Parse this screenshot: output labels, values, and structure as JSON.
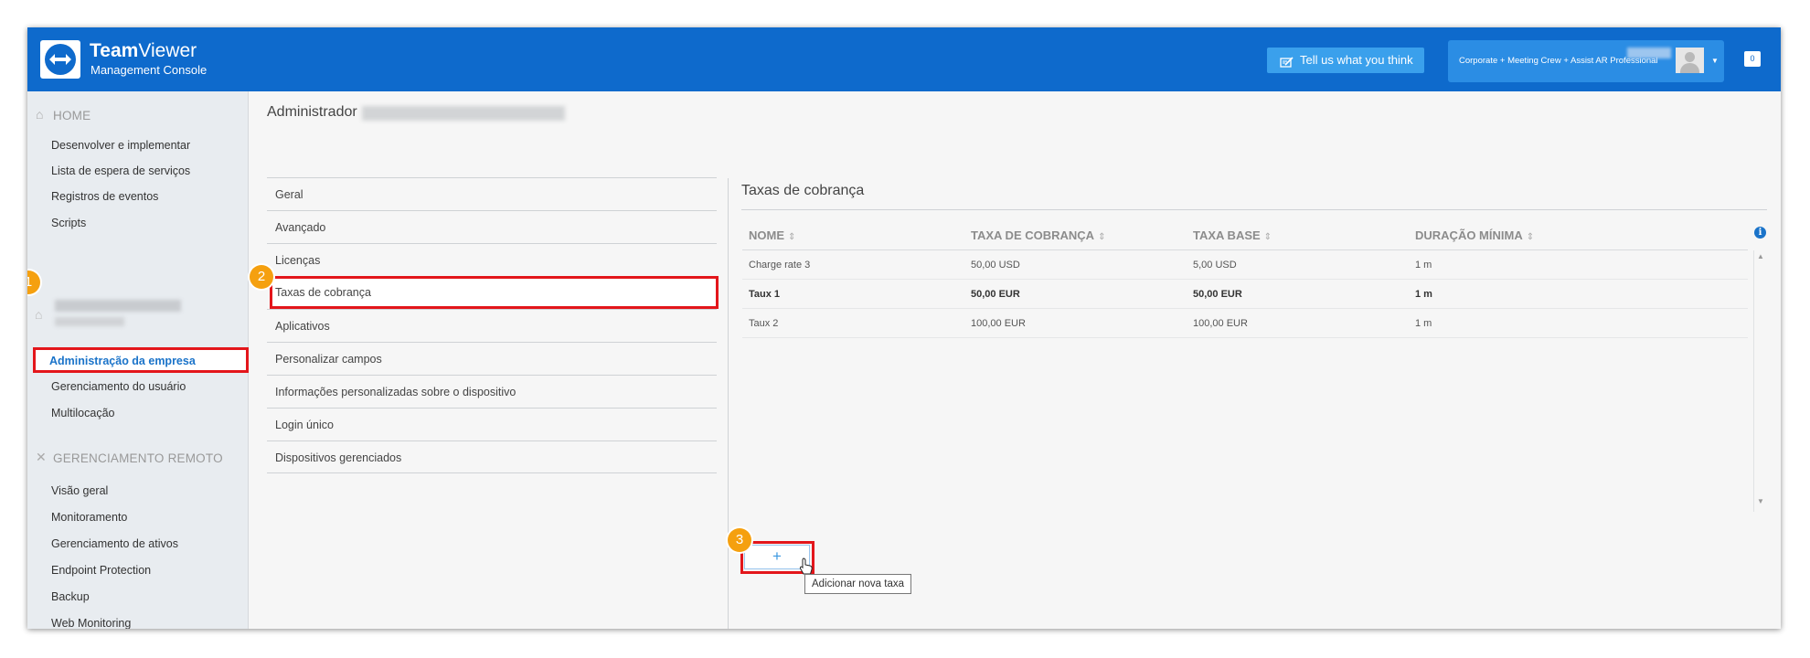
{
  "header": {
    "brand_bold": "Team",
    "brand_regular": "Viewer",
    "brand_subtitle": "Management Console",
    "feedback_label": "Tell us what you think",
    "license_label": "Corporate + Meeting Crew + Assist AR Professional",
    "notification_count": "0",
    "accent_color": "#0e6acc"
  },
  "sidebar": {
    "home_title": "HOME",
    "home_items": [
      "Desenvolver e implementar",
      "Lista de espera de serviços",
      "Registros de eventos",
      "Scripts"
    ],
    "company_items": [
      "Administração da empresa",
      "Gerenciamento do usuário",
      "Multilocação"
    ],
    "remote_title": "GERENCIAMENTO REMOTO",
    "remote_items": [
      "Visão geral",
      "Monitoramento",
      "Gerenciamento de ativos",
      "Endpoint Protection",
      "Backup",
      "Web Monitoring"
    ]
  },
  "main": {
    "page_title": "Administrador",
    "settings_menu": [
      "Geral",
      "Avançado",
      "Licenças",
      "Taxas de cobrança",
      "Aplicativos",
      "Personalizar campos",
      "Informações personalizadas sobre o dispositivo",
      "Login único",
      "Dispositivos gerenciados"
    ],
    "panel_title": "Taxas de cobrança",
    "table": {
      "columns": [
        "NOME",
        "TAXA DE COBRANÇA",
        "TAXA BASE",
        "DURAÇÃO MÍNIMA"
      ],
      "rows": [
        [
          "Charge rate 3",
          "50,00 USD",
          "5,00 USD",
          "1 m"
        ],
        [
          "Taux 1",
          "50,00 EUR",
          "50,00 EUR",
          "1 m"
        ],
        [
          "Taux 2",
          "100,00 EUR",
          "100,00 EUR",
          "1 m"
        ]
      ]
    },
    "add_button_label": "+",
    "tooltip": "Adicionar nova taxa"
  },
  "badges": [
    "1",
    "2",
    "3"
  ]
}
